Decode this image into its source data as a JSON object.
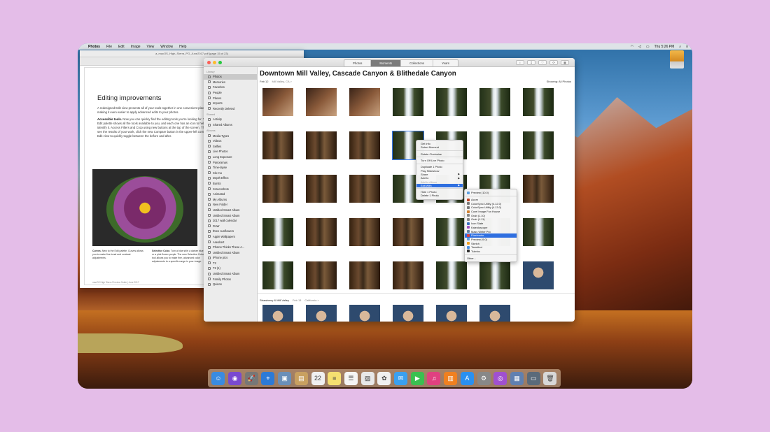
{
  "menubar": {
    "apple": "",
    "app": "Photos",
    "items": [
      "File",
      "Edit",
      "Image",
      "View",
      "Window",
      "Help"
    ],
    "clock": "Thu 5:26 PM"
  },
  "preview": {
    "window_title": "a_macOS_High_Sierra_PG_June2017.pdf (page 15 of 23)",
    "heading": "Editing improvements",
    "para1": "A redesigned Edit view presents all of your tools together in one convenient place, making it even easier to apply advanced edits to your photos.",
    "para2_bold": "Accessible tools.",
    "para2": " Now you can quickly find the editing tools you're looking for. The Edit palette shows all the tools available to you, and each one has an icon to help you identify it. Access Filters and Crop using new buttons at the top of the screen. Then to see the results of your work, click the new Compare button in the upper-left corner of Edit view to quickly toggle between the before and after.",
    "caption1_bold": "Curves.",
    "caption1": " New to the Edit palette, Curves allows you to make fine tonal and contrast adjustments.",
    "caption2_bold": "Selective Color.",
    "caption2": " Turn a blue shirt a darker blue or a pink flower purple. The new Selective Color tool allows you to make fine, advanced color adjustments to a specific range in your image.",
    "footer": "macOS High Sierra Preview Guide | June 2017"
  },
  "photos": {
    "tabs": [
      "Photos",
      "Moments",
      "Collections",
      "Years"
    ],
    "active_tab": "Moments",
    "toolbar_icons": [
      "i",
      "↥",
      "♡",
      "⟳",
      "▦"
    ],
    "sidebar": [
      {
        "type": "head",
        "label": "Library"
      },
      {
        "type": "item",
        "label": "Photos",
        "icon": "photos-icon",
        "selected": true
      },
      {
        "type": "item",
        "label": "Memories",
        "icon": "memories-icon"
      },
      {
        "type": "item",
        "label": "Favorites",
        "icon": "heart-icon"
      },
      {
        "type": "item",
        "label": "People",
        "icon": "people-icon"
      },
      {
        "type": "item",
        "label": "Places",
        "icon": "pin-icon"
      },
      {
        "type": "item",
        "label": "Imports",
        "icon": "clock-icon"
      },
      {
        "type": "item",
        "label": "Recently Deleted",
        "icon": "trash-icon"
      },
      {
        "type": "head",
        "label": "Shared"
      },
      {
        "type": "item",
        "label": "Activity",
        "icon": "cloud-icon"
      },
      {
        "type": "item",
        "label": "Shared Albums",
        "icon": "folder-icon"
      },
      {
        "type": "head",
        "label": "Albums"
      },
      {
        "type": "item",
        "label": "Media Types",
        "icon": "folder-icon"
      },
      {
        "type": "item",
        "label": "Videos",
        "icon": "video-icon"
      },
      {
        "type": "item",
        "label": "Selfies",
        "icon": "selfie-icon"
      },
      {
        "type": "item",
        "label": "Live Photos",
        "icon": "live-icon"
      },
      {
        "type": "item",
        "label": "Long Exposure",
        "icon": "exposure-icon"
      },
      {
        "type": "item",
        "label": "Panoramas",
        "icon": "pano-icon"
      },
      {
        "type": "item",
        "label": "Time-lapse",
        "icon": "timelapse-icon"
      },
      {
        "type": "item",
        "label": "Slo-mo",
        "icon": "slomo-icon"
      },
      {
        "type": "item",
        "label": "Depth Effect",
        "icon": "depth-icon"
      },
      {
        "type": "item",
        "label": "Bursts",
        "icon": "burst-icon"
      },
      {
        "type": "item",
        "label": "Screenshots",
        "icon": "screenshot-icon"
      },
      {
        "type": "item",
        "label": "Animated",
        "icon": "animated-icon"
      },
      {
        "type": "item",
        "label": "My Albums",
        "icon": "folder-icon"
      },
      {
        "type": "item",
        "label": "New Folder",
        "icon": "folder-icon"
      },
      {
        "type": "item",
        "label": "Untitled Smart Album",
        "icon": "smart-album-icon"
      },
      {
        "type": "item",
        "label": "Untitled Smart Album",
        "icon": "smart-album-icon"
      },
      {
        "type": "item",
        "label": "2017 wall calendar",
        "icon": "album-icon"
      },
      {
        "type": "item",
        "label": "RAW",
        "icon": "album-icon"
      },
      {
        "type": "item",
        "label": "three sunflowers",
        "icon": "album-icon"
      },
      {
        "type": "item",
        "label": "Apple Wallpapers",
        "icon": "album-icon"
      },
      {
        "type": "item",
        "label": "Aseobert",
        "icon": "album-icon"
      },
      {
        "type": "item",
        "label": "Photos Thinks These A...",
        "icon": "album-icon"
      },
      {
        "type": "item",
        "label": "Untitled Smart Album",
        "icon": "smart-album-icon"
      },
      {
        "type": "item",
        "label": "iPhone pics",
        "icon": "smart-album-icon"
      },
      {
        "type": "item",
        "label": "T2",
        "icon": "smart-album-icon"
      },
      {
        "type": "item",
        "label": "T2 (1)",
        "icon": "smart-album-icon"
      },
      {
        "type": "item",
        "label": "Untitled Smart Album",
        "icon": "smart-album-icon"
      },
      {
        "type": "item",
        "label": "Family Photos",
        "icon": "smart-album-icon"
      },
      {
        "type": "item",
        "label": "Quinns",
        "icon": "smart-album-icon"
      }
    ],
    "moment_title": "Downtown Mill Valley, Cascade Canyon & Blithedale Canyon",
    "date": "Feb 12",
    "location": "Mill Valley, CA  >",
    "showing": "Showing: All Photos",
    "section2_title": "Strawberry & Mill Valley",
    "section2_date": "Feb 13",
    "section2_location": "California  >",
    "grid": [
      [
        "room",
        "room",
        "room",
        "falls",
        "falls",
        "falls",
        "falls"
      ],
      [
        "trees",
        "trees",
        "trees",
        "falls",
        "falls",
        "falls",
        "falls"
      ],
      [
        "trees",
        "trees",
        "trees",
        "falls",
        "falls",
        "falls",
        "trees"
      ],
      [
        "falls",
        "trees",
        "trees",
        "trees",
        "falls",
        "falls",
        "falls"
      ],
      [
        "falls",
        "trees",
        "trees",
        "trees",
        "falls",
        "falls",
        "face"
      ]
    ],
    "grid2": [
      "face",
      "face",
      "face",
      "face",
      "face",
      "face"
    ]
  },
  "context_menu": [
    {
      "label": "Get Info"
    },
    {
      "label": "Select Moment"
    },
    {
      "sep": true
    },
    {
      "label": "Rotate Clockwise"
    },
    {
      "sep": true
    },
    {
      "label": "Turn Off Live Photo"
    },
    {
      "sep": true
    },
    {
      "label": "Duplicate 1 Photo"
    },
    {
      "label": "Play Slideshow"
    },
    {
      "label": "Share",
      "submenu": true
    },
    {
      "label": "Add to",
      "submenu": true
    },
    {
      "label": "Add to Album",
      "disabled": true
    },
    {
      "label": "Edit With",
      "submenu": true,
      "highlighted": true
    },
    {
      "sep": true
    },
    {
      "label": "Hide 1 Photo"
    },
    {
      "label": "Delete 1 Photo"
    }
  ],
  "edit_with_menu": [
    {
      "label": "Preview (10.0)",
      "color": "#5fa0e0"
    },
    {
      "sep": true
    },
    {
      "label": "Acorn",
      "color": "#c04020"
    },
    {
      "label": "ColorSync Utility (4.12.0)",
      "color": "#7a7a7a"
    },
    {
      "label": "ColorSync Utility (4.13.0)",
      "color": "#7a7a7a"
    },
    {
      "label": "Corel Image Fun House",
      "color": "#d08030"
    },
    {
      "label": "Grab (1.10)",
      "color": "#888"
    },
    {
      "label": "Grab (1.11)",
      "color": "#888"
    },
    {
      "label": "Icon Slate",
      "color": "#3a70c0"
    },
    {
      "label": "Kaleidoscope",
      "color": "#a050c0"
    },
    {
      "label": "Mass Writer Pro",
      "color": "#6080a0"
    },
    {
      "label": "Pixelmator",
      "color": "#e04040",
      "highlighted": true
    },
    {
      "label": "Preview (9.0)",
      "color": "#5fa0e0"
    },
    {
      "label": "Sketch",
      "color": "#f0a020"
    },
    {
      "label": "Tweetbot",
      "color": "#4a90e0"
    },
    {
      "label": "Tuimbo",
      "color": "#303030"
    },
    {
      "sep": true
    },
    {
      "label": "Other..."
    }
  ],
  "dock": [
    {
      "name": "finder-icon",
      "color": "#3a8be0",
      "glyph": "☺"
    },
    {
      "name": "siri-icon",
      "color": "#7a4ad0",
      "glyph": "◉"
    },
    {
      "name": "launchpad-icon",
      "color": "#777",
      "glyph": "🚀"
    },
    {
      "name": "safari-icon",
      "color": "#2d7ad6",
      "glyph": "⌖"
    },
    {
      "name": "preview-icon",
      "color": "#6a8fb8",
      "glyph": "▣"
    },
    {
      "name": "notes-folder-icon",
      "color": "#c8a060",
      "glyph": "▤"
    },
    {
      "name": "calendar-icon",
      "color": "#f0f0f0",
      "glyph": "22"
    },
    {
      "name": "notes-icon",
      "color": "#f5e070",
      "glyph": "≡"
    },
    {
      "name": "reminders-icon",
      "color": "#f5f5f5",
      "glyph": "☰"
    },
    {
      "name": "preview-doc-icon",
      "color": "#e8e8e8",
      "glyph": "▨"
    },
    {
      "name": "photos-icon",
      "color": "#f0f0f0",
      "glyph": "✿"
    },
    {
      "name": "messages-icon",
      "color": "#3aa0f0",
      "glyph": "✉"
    },
    {
      "name": "facetime-icon",
      "color": "#3ac050",
      "glyph": "▶"
    },
    {
      "name": "itunes-icon",
      "color": "#e04080",
      "glyph": "♫"
    },
    {
      "name": "ibooks-icon",
      "color": "#f08020",
      "glyph": "▥"
    },
    {
      "name": "app-store-icon",
      "color": "#2a90f0",
      "glyph": "A"
    },
    {
      "name": "system-preferences-icon",
      "color": "#888",
      "glyph": "⚙"
    },
    {
      "name": "podcasts-icon",
      "color": "#a050d0",
      "glyph": "◎"
    },
    {
      "name": "image-capture-icon",
      "color": "#6080b0",
      "glyph": "▦"
    },
    {
      "name": "downloads-folder-icon",
      "color": "#5a6a7a",
      "glyph": "▭"
    },
    {
      "name": "trash-icon",
      "color": "#d8d8d8",
      "glyph": "🗑"
    }
  ]
}
